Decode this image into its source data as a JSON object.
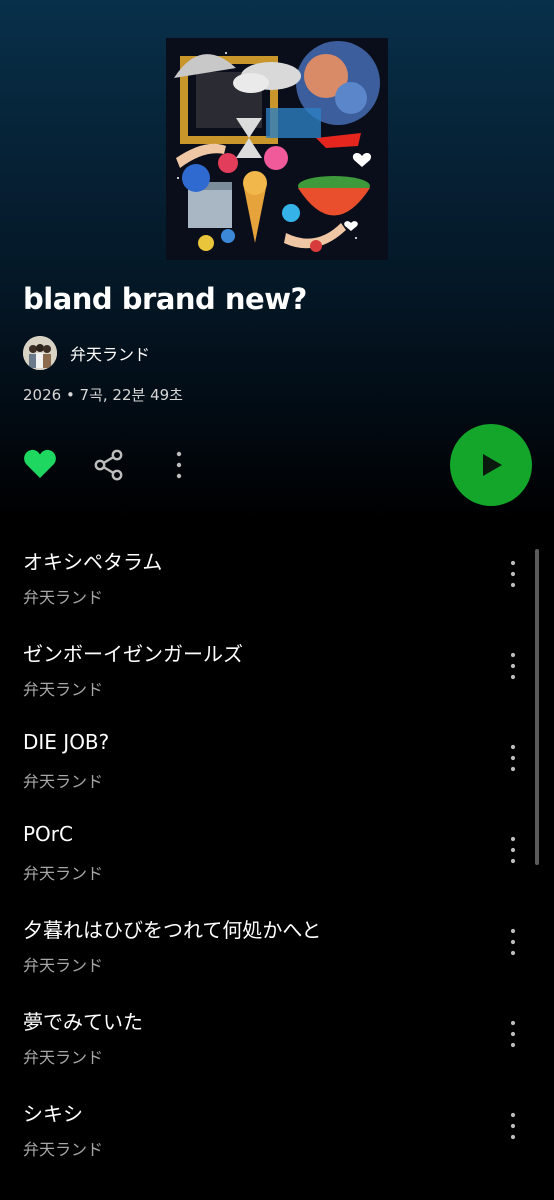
{
  "album": {
    "title": "bland brand new?",
    "artist": "弁天ランド",
    "meta": "2026 • 7곡, 22분 49초",
    "liked": true
  },
  "icons": {
    "cover": "album-cover-art",
    "avatar": "artist-avatar",
    "like": "heart-icon",
    "share": "share-icon",
    "more": "more-vertical-icon",
    "play": "play-icon"
  },
  "colors": {
    "accent": "#1ed760",
    "play_button": "#14a52b",
    "background_top": "#08304a",
    "secondary_text": "#a7a7a7"
  },
  "tracks": [
    {
      "title": "オキシペタラム",
      "artist": "弁天ランド"
    },
    {
      "title": "ゼンボーイゼンガールズ",
      "artist": "弁天ランド"
    },
    {
      "title": "DIE JOB?",
      "artist": "弁天ランド"
    },
    {
      "title": "POrC",
      "artist": "弁天ランド"
    },
    {
      "title": "夕暮れはひびをつれて何処かへと",
      "artist": "弁天ランド"
    },
    {
      "title": "夢でみていた",
      "artist": "弁天ランド"
    },
    {
      "title": "シキシ",
      "artist": "弁天ランド"
    }
  ]
}
